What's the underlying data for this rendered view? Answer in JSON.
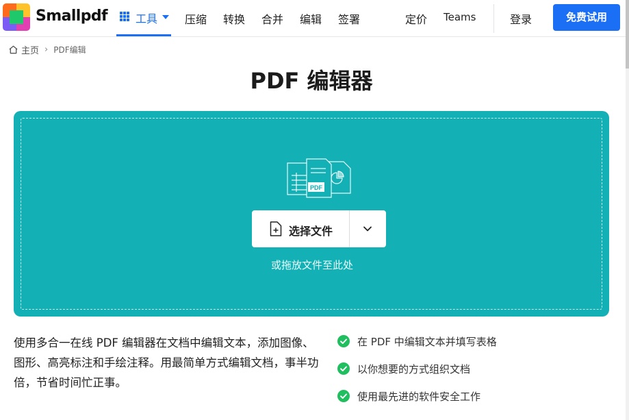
{
  "header": {
    "brand": "Smallpdf",
    "tools_label": "工具",
    "nav": [
      "压缩",
      "转换",
      "合并",
      "编辑",
      "签署"
    ],
    "pricing": "定价",
    "teams": "Teams",
    "login": "登录",
    "trial_button": "免费试用"
  },
  "breadcrumb": {
    "home": "主页",
    "current": "PDF编辑"
  },
  "page_title": "PDF 编辑器",
  "dropzone": {
    "pdf_badge": "PDF",
    "select_button": "选择文件",
    "hint": "或拖放文件至此处"
  },
  "description": "使用多合一在线 PDF 编辑器在文档中编辑文本，添加图像、图形、高亮标注和手绘注释。用最简单方式编辑文档，事半功倍，节省时间忙正事。",
  "features": [
    "在 PDF 中编辑文本并填写表格",
    "以你想要的方式组织文档",
    "使用最先进的软件安全工作"
  ],
  "colors": {
    "accent": "#1b6ff5",
    "dropzone": "#13b1b5",
    "check": "#1fbf5f"
  },
  "icons": {
    "tools": "grid-icon",
    "home": "home-icon",
    "select": "file-plus-icon",
    "dropdown": "chevron-down-icon",
    "feature": "check-circle-icon"
  }
}
